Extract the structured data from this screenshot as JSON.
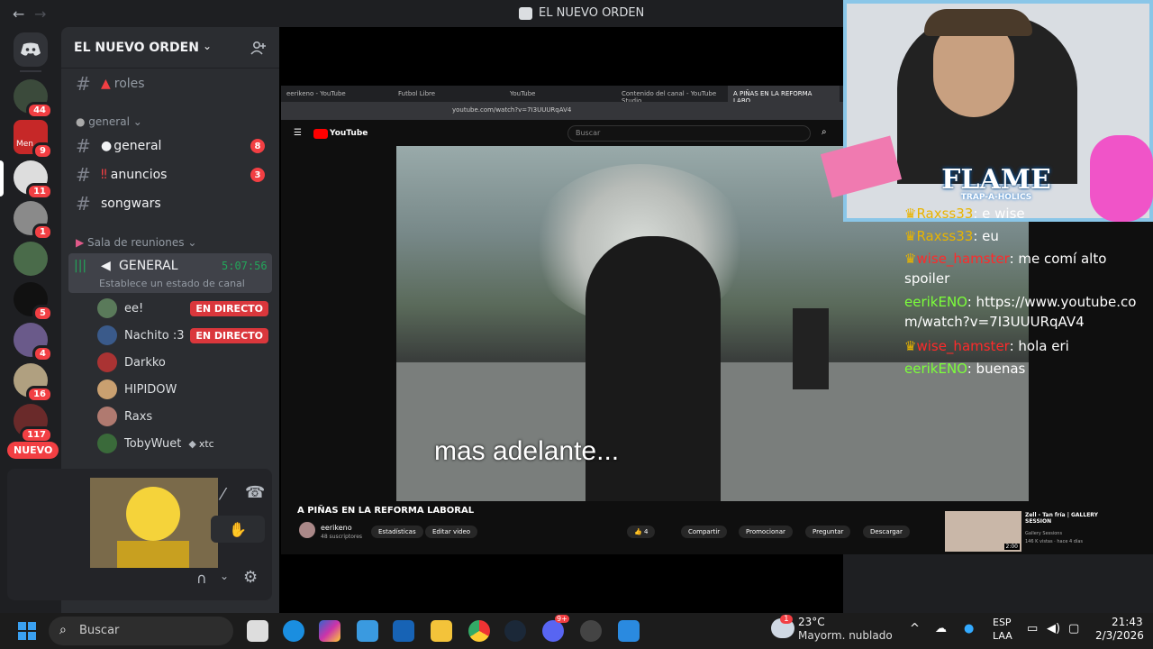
{
  "window": {
    "title": "EL NUEVO ORDEN",
    "back": "←",
    "forward": "→"
  },
  "servers": [
    {
      "badge": "44"
    },
    {
      "badge": "9",
      "label": "Men"
    },
    {
      "badge": "11"
    },
    {
      "badge": "1"
    },
    {
      "badge": ""
    },
    {
      "badge": "5"
    },
    {
      "badge": "4"
    },
    {
      "badge": "16"
    },
    {
      "badge": "117"
    }
  ],
  "new_label": "NUEVO",
  "guild": {
    "name": "EL NUEVO ORDEN",
    "chevron": "⌄"
  },
  "channels": {
    "roles": "roles",
    "cat_general": "general",
    "general": "general",
    "general_badge": "8",
    "anuncios": "anuncios",
    "anuncios_badge": "3",
    "songwars": "songwars",
    "cat_voice": "Sala de reuniones",
    "voice": "GENERAL",
    "voice_time": "5:07:56",
    "voice_status": "Establece un estado de canal"
  },
  "voice_users": [
    {
      "name": "ee!",
      "live": "EN DIRECTO"
    },
    {
      "name": "Nachito :3",
      "live": "EN DIRECTO"
    },
    {
      "name": "Darkko",
      "live": ""
    },
    {
      "name": "HIPIDOW",
      "live": ""
    },
    {
      "name": "Raxs",
      "live": ""
    },
    {
      "name": "TobyWuet",
      "live": "",
      "tag": "xtc"
    }
  ],
  "browser": {
    "tabs": [
      "eerikeno - YouTube",
      "Futbol Libre",
      "YouTube",
      "Contenido del canal - YouTube Studio",
      "A PIÑAS EN LA REFORMA LABO..."
    ],
    "url": "youtube.com/watch?v=7I3UUURqAV4",
    "search_placeholder": "Buscar",
    "logo": "YouTube",
    "subtitle": "mas adelante...",
    "video_title": "A PIÑAS EN LA REFORMA LABORAL",
    "channel": "eerikeno",
    "subs": "48 suscriptores",
    "btn_stats": "Estadísticas",
    "btn_edit": "Editar video",
    "likes": "4",
    "share": "Compartir",
    "promote": "Promocionar",
    "ask": "Preguntar",
    "download": "Descargar",
    "rec_title": "Zell - Tan fría | GALLERY SESSION",
    "rec_channel": "Gallery Sessions",
    "rec_meta": "146 K vistas · hace 4 días",
    "rec_duration": "2:00"
  },
  "overlay": {
    "brand": "FLAME",
    "sub": "TRAP-A-HOLICS"
  },
  "chat": [
    {
      "user": "Raxss33",
      "text": ": e wise",
      "color": "#e8b400"
    },
    {
      "user": "Raxss33",
      "text": ": eu",
      "color": "#e8b400"
    },
    {
      "user": "wise_hamster",
      "text": ": me comí alto spoiler",
      "color": "#ff2a2a"
    },
    {
      "user": "eerikENO",
      "text": ": https://www.youtube.com/watch?v=7I3UUURqAV4",
      "color": "#7cff3a"
    },
    {
      "user": "wise_hamster",
      "text": ": hola eri",
      "color": "#ff2a2a"
    },
    {
      "user": "eerikENO",
      "text": ": buenas",
      "color": "#7cff3a"
    }
  ],
  "taskbar": {
    "search": "Buscar",
    "weather_temp": "23°C",
    "weather_desc": "Mayorm. nublado",
    "weather_badge": "1",
    "lang1": "ESP",
    "lang2": "LAA",
    "time": "21:43",
    "date": "2/3/2026",
    "discord_badge": "9+"
  },
  "colors": {
    "accent": "#5865f2",
    "red": "#f23f43",
    "green": "#23a55a"
  }
}
